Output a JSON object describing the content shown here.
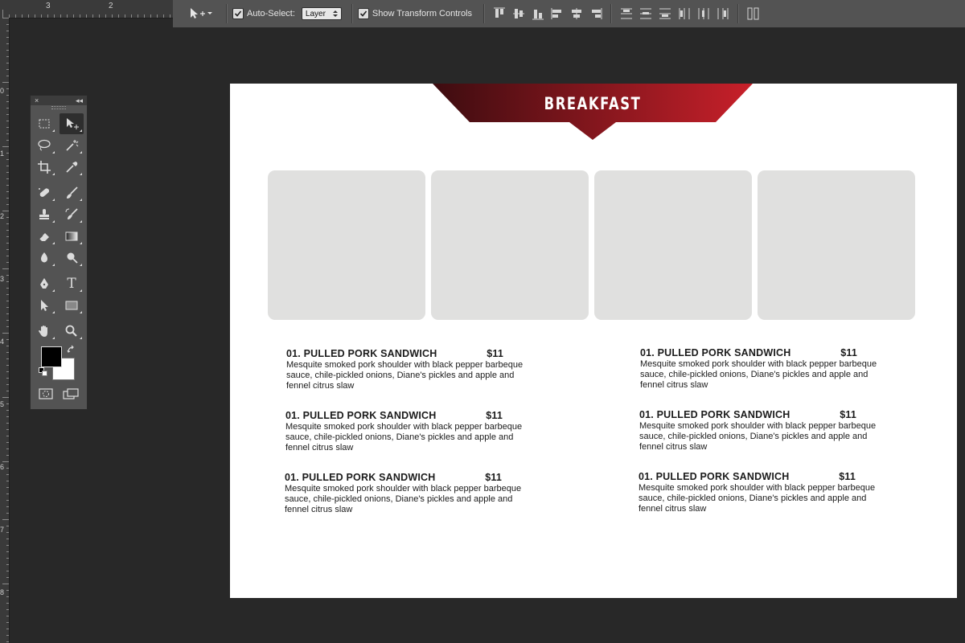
{
  "rulers": {
    "top_numbers": [
      "3",
      "2"
    ],
    "left_numbers": [
      "0",
      "1",
      "2",
      "3",
      "4",
      "5",
      "6",
      "7",
      "8"
    ]
  },
  "options_bar": {
    "auto_select_label": "Auto-Select:",
    "auto_select_checked": true,
    "auto_select_value": "Layer",
    "transform_label": "Show Transform Controls",
    "transform_checked": true,
    "align_icons": [
      "align-top-edges-icon",
      "align-vertical-centers-icon",
      "align-bottom-edges-icon",
      "align-left-edges-icon",
      "align-horizontal-centers-icon",
      "align-right-edges-icon",
      "distribute-top-icon",
      "distribute-vertical-centers-icon",
      "distribute-bottom-icon",
      "distribute-left-icon",
      "distribute-horizontal-centers-icon",
      "distribute-right-icon",
      "auto-align-layers-icon"
    ]
  },
  "tools_panel": {
    "close_glyph": "×",
    "collapse_glyph": "◂◂",
    "tools": [
      "rectangular-marquee-icon",
      "move-tool-icon",
      "lasso-icon",
      "magic-wand-icon",
      "crop-icon",
      "eyedropper-icon",
      "spot-healing-icon",
      "brush-icon",
      "clone-stamp-icon",
      "history-brush-icon",
      "eraser-icon",
      "gradient-icon",
      "blur-icon",
      "dodge-icon",
      "pen-icon",
      "type-icon",
      "path-selection-icon",
      "rectangle-icon",
      "hand-icon",
      "zoom-icon"
    ],
    "type_glyph": "T",
    "active_tool": "move-tool-icon",
    "foreground_color": "#000000",
    "background_color": "#ffffff"
  },
  "document": {
    "banner_title": "BREAKFAST",
    "banner_colors": [
      "#3d0c10",
      "#c8202a"
    ],
    "menu_items": [
      {
        "name": "01. PULLED PORK SANDWICH",
        "price": "$11",
        "desc": "Mesquite smoked pork shoulder with black pepper barbeque sauce, chile-pickled onions, Diane's pickles and apple and fennel citrus slaw"
      },
      {
        "name": "01. PULLED PORK SANDWICH",
        "price": "$11",
        "desc": "Mesquite smoked pork shoulder with black pepper barbeque sauce, chile-pickled onions, Diane's pickles and apple and fennel citrus slaw"
      },
      {
        "name": "01. PULLED PORK SANDWICH",
        "price": "$11",
        "desc": "Mesquite smoked pork shoulder with black pepper barbeque sauce, chile-pickled onions, Diane's pickles and apple and fennel citrus slaw"
      },
      {
        "name": "01. PULLED PORK SANDWICH",
        "price": "$11",
        "desc": "Mesquite smoked pork shoulder with black pepper barbeque sauce, chile-pickled onions, Diane's pickles and apple and fennel citrus slaw"
      },
      {
        "name": "01. PULLED PORK SANDWICH",
        "price": "$11",
        "desc": "Mesquite smoked pork shoulder with black pepper barbeque sauce, chile-pickled onions, Diane's pickles and apple and fennel citrus slaw"
      },
      {
        "name": "01. PULLED PORK SANDWICH",
        "price": "$11",
        "desc": "Mesquite smoked pork shoulder with black pepper barbeque sauce, chile-pickled onions, Diane's pickles and apple and fennel citrus slaw"
      }
    ]
  }
}
